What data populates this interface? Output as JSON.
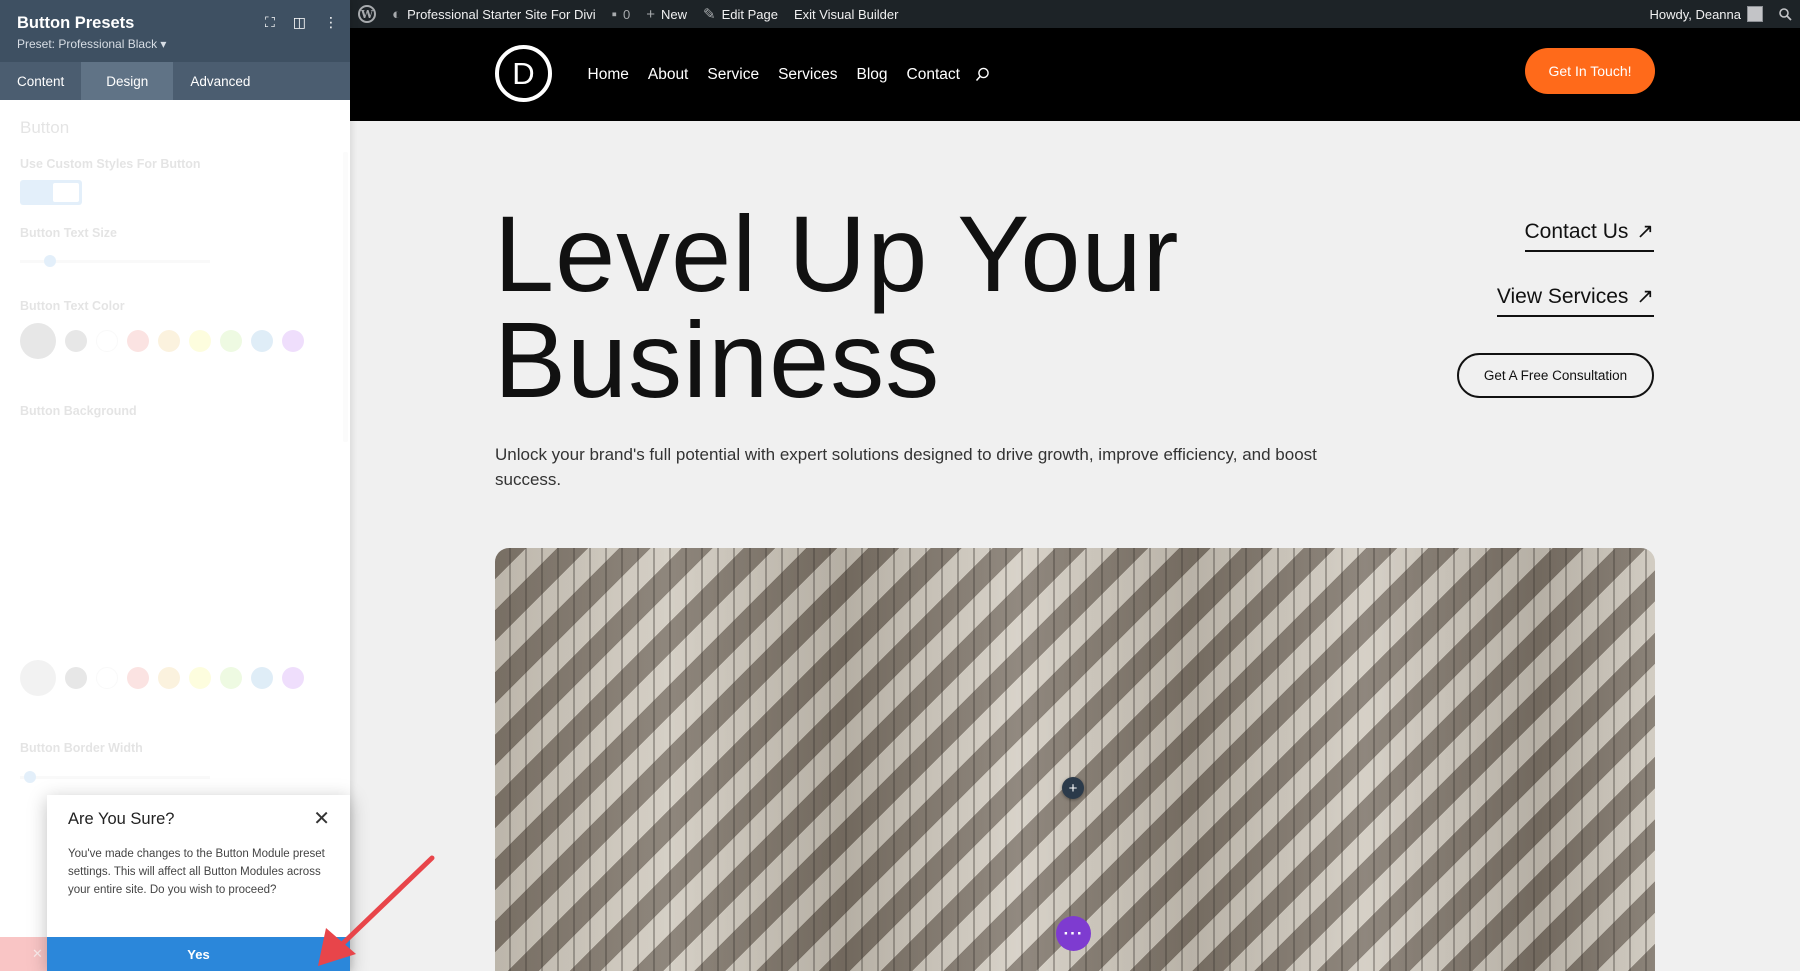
{
  "admin_bar": {
    "site_name": "Professional Starter Site For Divi",
    "comments_count": "0",
    "new_label": "New",
    "edit_page_label": "Edit Page",
    "exit_builder_label": "Exit Visual Builder",
    "howdy": "Howdy, Deanna"
  },
  "site": {
    "logo_letter": "D",
    "nav": [
      "Home",
      "About",
      "Service",
      "Services",
      "Blog",
      "Contact"
    ],
    "cta": "Get In Touch!"
  },
  "hero": {
    "title_line1": "Level Up Your",
    "title_line2": "Business",
    "subtitle": "Unlock your brand's full potential with expert solutions designed to drive growth, improve efficiency, and boost success.",
    "link_contact": "Contact Us",
    "link_services": "View Services",
    "outline_button": "Get A Free Consultation",
    "arrow_glyph": "↗"
  },
  "panel": {
    "title": "Button Presets",
    "preset": "Preset: Professional Black ▾",
    "tabs": [
      "Content",
      "Design",
      "Advanced"
    ],
    "active_tab": "Design",
    "group_title": "Button",
    "options": {
      "custom_styles": "Use Custom Styles For Button",
      "text_size": "Button Text Size",
      "text_color": "Button Text Color",
      "background": "Button Background",
      "border_width": "Button Border Width"
    }
  },
  "dialog": {
    "title": "Are You Sure?",
    "message": "You've made changes to the Button Module preset settings. This will affect all Button Modules across your entire site. Do you wish to proceed?",
    "confirm": "Yes"
  },
  "colors": {
    "accent_orange": "#ff6a1a",
    "divi_blue": "#2b87da",
    "panel_header": "#3e5062",
    "purple": "#7e3bd0",
    "annotation_red": "#e8454a"
  }
}
